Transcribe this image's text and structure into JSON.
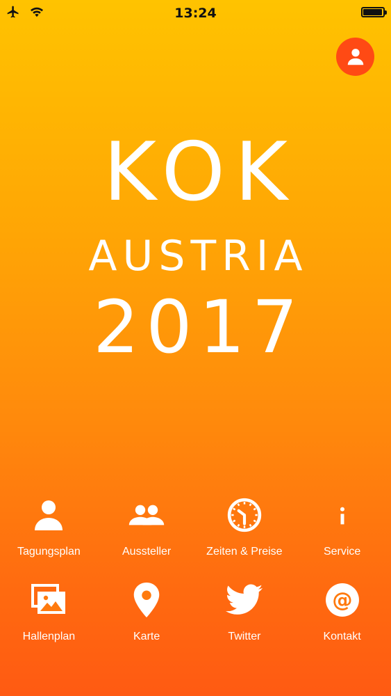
{
  "status_bar": {
    "time": "13:24",
    "battery_level": 0.95
  },
  "logo": {
    "line1": "KOK",
    "line2": "AUSTRIA",
    "line3": "2017"
  },
  "menu": [
    {
      "label": "Tagungsplan",
      "icon": "person-icon"
    },
    {
      "label": "Aussteller",
      "icon": "people-icon"
    },
    {
      "label": "Zeiten & Preise",
      "icon": "clock-icon"
    },
    {
      "label": "Service",
      "icon": "info-icon"
    },
    {
      "label": "Hallenplan",
      "icon": "images-icon"
    },
    {
      "label": "Karte",
      "icon": "map-pin-icon"
    },
    {
      "label": "Twitter",
      "icon": "twitter-icon"
    },
    {
      "label": "Kontakt",
      "icon": "at-icon"
    }
  ],
  "colors": {
    "profile_button": "#FF4A14",
    "gradient_top": "#FFC300",
    "gradient_bottom": "#FF5A12"
  }
}
